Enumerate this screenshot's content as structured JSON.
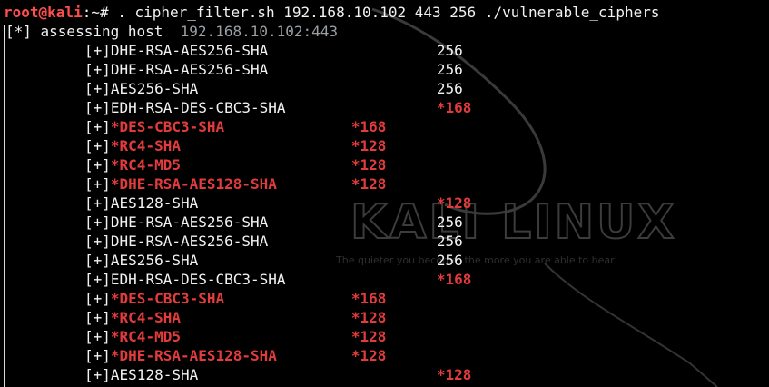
{
  "prompt": {
    "user": "root@kali",
    "path": ":~#",
    "command": " . cipher_filter.sh 192.168.10.102 443 256 ./vulnerable_ciphers"
  },
  "status": {
    "label": "[*] assessing host",
    "host": "192.168.10.102:443"
  },
  "wallpaper": {
    "title": "KALI LINUX",
    "tagline": "The quieter you become, the more you are able to hear"
  },
  "rows": [
    {
      "prefix": "[+]",
      "name": "DHE-RSA-AES256-SHA",
      "bits": "256",
      "weak": false,
      "col": 2
    },
    {
      "prefix": "[+]",
      "name": "DHE-RSA-AES256-SHA",
      "bits": "256",
      "weak": false,
      "col": 2
    },
    {
      "prefix": "[+]",
      "name": "AES256-SHA",
      "bits": "256",
      "weak": false,
      "col": 2
    },
    {
      "prefix": "[+]",
      "name": "EDH-RSA-DES-CBC3-SHA",
      "bits": "*168",
      "weak": false,
      "col": 2
    },
    {
      "prefix": "[+]",
      "name": "*DES-CBC3-SHA",
      "bits": "*168",
      "weak": true,
      "col": 1
    },
    {
      "prefix": "[+]",
      "name": "*RC4-SHA",
      "bits": "*128",
      "weak": true,
      "col": 1
    },
    {
      "prefix": "[+]",
      "name": "*RC4-MD5",
      "bits": "*128",
      "weak": true,
      "col": 1
    },
    {
      "prefix": "[+]",
      "name": "*DHE-RSA-AES128-SHA",
      "bits": "*128",
      "weak": true,
      "col": 1
    },
    {
      "prefix": "[+]",
      "name": "AES128-SHA",
      "bits": "*128",
      "weak": false,
      "col": 2
    },
    {
      "prefix": "[+]",
      "name": "DHE-RSA-AES256-SHA",
      "bits": "256",
      "weak": false,
      "col": 2
    },
    {
      "prefix": "[+]",
      "name": "DHE-RSA-AES256-SHA",
      "bits": "256",
      "weak": false,
      "col": 2
    },
    {
      "prefix": "[+]",
      "name": "AES256-SHA",
      "bits": "256",
      "weak": false,
      "col": 2
    },
    {
      "prefix": "[+]",
      "name": "EDH-RSA-DES-CBC3-SHA",
      "bits": "*168",
      "weak": false,
      "col": 2
    },
    {
      "prefix": "[+]",
      "name": "*DES-CBC3-SHA",
      "bits": "*168",
      "weak": true,
      "col": 1
    },
    {
      "prefix": "[+]",
      "name": "*RC4-SHA",
      "bits": "*128",
      "weak": true,
      "col": 1
    },
    {
      "prefix": "[+]",
      "name": "*RC4-MD5",
      "bits": "*128",
      "weak": true,
      "col": 1
    },
    {
      "prefix": "[+]",
      "name": "*DHE-RSA-AES128-SHA",
      "bits": "*128",
      "weak": true,
      "col": 1
    },
    {
      "prefix": "[+]",
      "name": "AES128-SHA",
      "bits": "*128",
      "weak": false,
      "col": 2
    }
  ],
  "colors": {
    "background": "#000000",
    "text": "#f2f2f2",
    "prompt": "#ff4d4d",
    "weak": "#e23b3b",
    "host": "#9aa0a6"
  }
}
